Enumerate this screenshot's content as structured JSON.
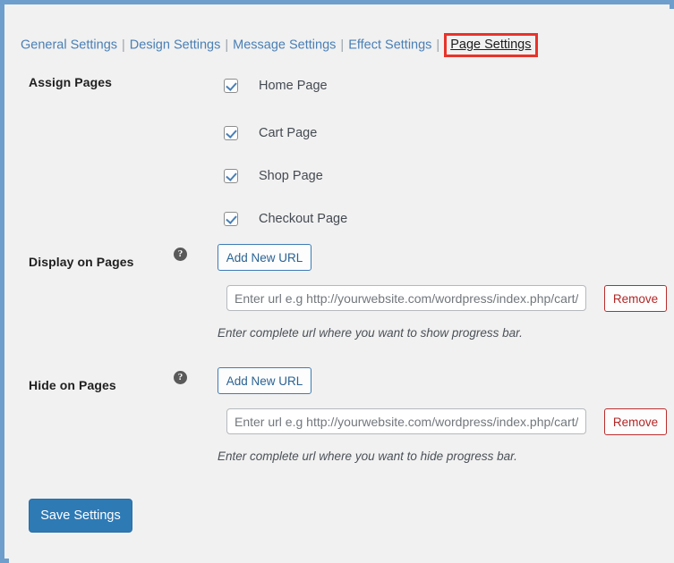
{
  "window": {
    "background_color": "#f1f1f1",
    "frame_color": "#6e9ecb"
  },
  "tabs": {
    "separator": "|",
    "items": [
      {
        "label": "General Settings",
        "active": false
      },
      {
        "label": "Design Settings",
        "active": false
      },
      {
        "label": "Message Settings",
        "active": false
      },
      {
        "label": "Effect Settings",
        "active": false
      },
      {
        "label": "Page Settings",
        "active": true
      }
    ],
    "active_label": "Page Settings",
    "highlight_color": "#e8332a",
    "link_color": "#4a7fb5"
  },
  "assign_pages": {
    "label": "Assign Pages",
    "checkboxes": [
      {
        "label": "Home Page",
        "checked": true
      },
      {
        "label": "Cart Page",
        "checked": true
      },
      {
        "label": "Shop Page",
        "checked": true
      },
      {
        "label": "Checkout Page",
        "checked": true
      }
    ]
  },
  "display_on_pages": {
    "label": "Display on Pages",
    "help_icon": "question-mark-icon",
    "help_glyph": "?",
    "add_button_label": "Add New URL",
    "url_value": "",
    "url_placeholder": "Enter url e.g http://yourwebsite.com/wordpress/index.php/cart/",
    "remove_button_label": "Remove",
    "hint": "Enter complete url where you want to show progress bar."
  },
  "hide_on_pages": {
    "label": "Hide on Pages",
    "help_icon": "question-mark-icon",
    "help_glyph": "?",
    "add_button_label": "Add New URL",
    "url_value": "",
    "url_placeholder": "Enter url e.g http://yourwebsite.com/wordpress/index.php/cart/",
    "remove_button_label": "Remove",
    "hint": "Enter complete url where you want to hide progress bar."
  },
  "footer": {
    "save_label": "Save Settings",
    "save_color": "#2e7ab5"
  }
}
